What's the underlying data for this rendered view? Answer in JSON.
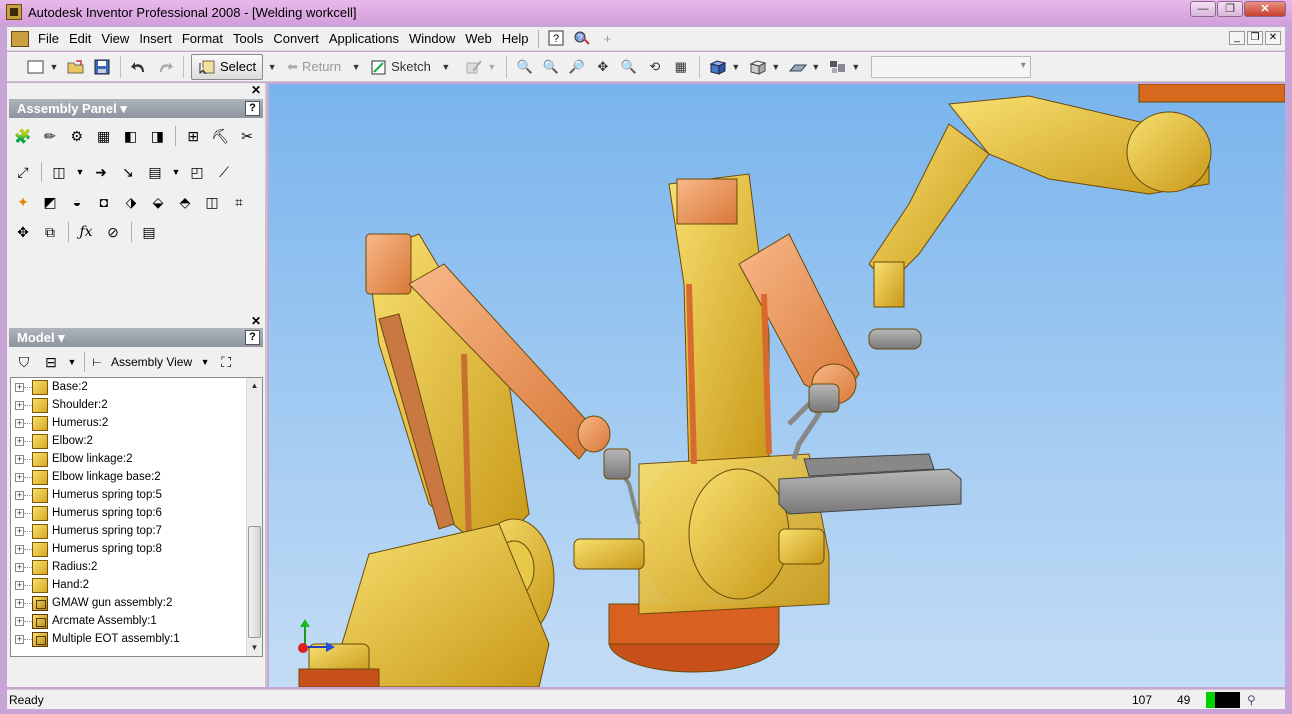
{
  "window": {
    "title": "Autodesk Inventor Professional 2008 - [Welding workcell]",
    "controls": [
      "—",
      "❐",
      "✕"
    ]
  },
  "menu": {
    "items": [
      "File",
      "Edit",
      "View",
      "Insert",
      "Format",
      "Tools",
      "Convert",
      "Applications",
      "Window",
      "Web",
      "Help"
    ]
  },
  "toolbar": {
    "select_label": "Select",
    "return_label": "Return",
    "sketch_label": "Sketch",
    "combo_value": ""
  },
  "assembly_panel": {
    "title": "Assembly Panel ▾",
    "help": "?"
  },
  "model_panel": {
    "title": "Model ▾",
    "help": "?",
    "view_label": "Assembly View",
    "tree": [
      {
        "label": "Base:2",
        "kind": "part"
      },
      {
        "label": "Shoulder:2",
        "kind": "part"
      },
      {
        "label": "Humerus:2",
        "kind": "part"
      },
      {
        "label": "Elbow:2",
        "kind": "part"
      },
      {
        "label": "Elbow linkage:2",
        "kind": "part"
      },
      {
        "label": "Elbow linkage base:2",
        "kind": "part"
      },
      {
        "label": "Humerus spring top:5",
        "kind": "part"
      },
      {
        "label": "Humerus spring top:6",
        "kind": "part"
      },
      {
        "label": "Humerus spring top:7",
        "kind": "part"
      },
      {
        "label": "Humerus spring top:8",
        "kind": "part"
      },
      {
        "label": "Radius:2",
        "kind": "part"
      },
      {
        "label": "Hand:2",
        "kind": "part"
      },
      {
        "label": "GMAW gun assembly:2",
        "kind": "assembly"
      },
      {
        "label": "Arcmate Assembly:1",
        "kind": "assembly"
      },
      {
        "label": "Multiple EOT assembly:1",
        "kind": "assembly"
      }
    ]
  },
  "status": {
    "text": "Ready",
    "coord_a": "107",
    "coord_b": "49"
  }
}
